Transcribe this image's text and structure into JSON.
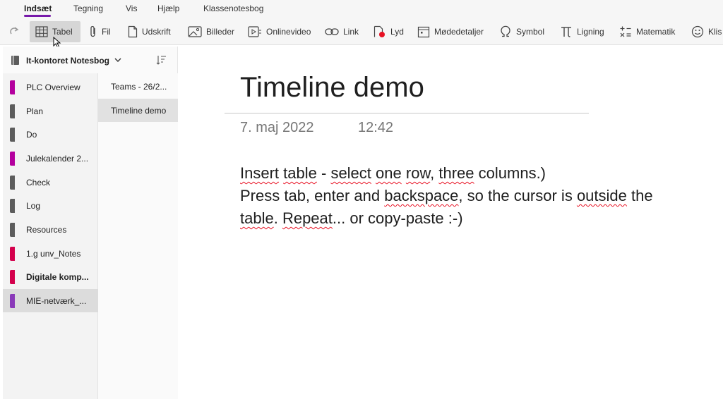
{
  "ribbon": {
    "tabs": [
      {
        "label": "Indsæt",
        "active": true
      },
      {
        "label": "Tegning"
      },
      {
        "label": "Vis"
      },
      {
        "label": "Hjælp"
      },
      {
        "label": "Klassenotesbog"
      }
    ],
    "tools": [
      {
        "label": "Tabel",
        "icon": "table-icon"
      },
      {
        "label": "Fil",
        "icon": "paperclip-icon"
      },
      {
        "label": "Udskrift",
        "icon": "document-icon"
      },
      {
        "label": "Billeder",
        "icon": "image-icon"
      },
      {
        "label": "Onlinevideo",
        "icon": "video-icon"
      },
      {
        "label": "Link",
        "icon": "link-icon"
      },
      {
        "label": "Lyd",
        "icon": "audio-record-icon"
      },
      {
        "label": "Mødedetaljer",
        "icon": "calendar-icon"
      },
      {
        "label": "Symbol",
        "icon": "omega-icon"
      },
      {
        "label": "Ligning",
        "icon": "pi-icon"
      },
      {
        "label": "Matematik",
        "icon": "math-icon"
      },
      {
        "label": "Klis",
        "icon": "sticker-icon"
      }
    ],
    "accent_color": "#7719aa"
  },
  "notebook": {
    "name": "It-kontoret Notesbog",
    "sections": [
      {
        "label": "PLC Overview",
        "color": "#b4009e"
      },
      {
        "label": "Plan",
        "color": "#5c5c5c"
      },
      {
        "label": "Do",
        "color": "#5c5c5c"
      },
      {
        "label": "Julekalender 2...",
        "color": "#b4009e"
      },
      {
        "label": "Check",
        "color": "#5c5c5c"
      },
      {
        "label": "Log",
        "color": "#5c5c5c"
      },
      {
        "label": "Resources",
        "color": "#5c5c5c"
      },
      {
        "label": "1.g unv_Notes",
        "color": "#d4004c"
      },
      {
        "label": "Digitale komp...",
        "color": "#d4004c",
        "bold": true
      },
      {
        "label": "MIE-netværk_...",
        "color": "#8a3ab9",
        "selected": true
      }
    ],
    "pages": [
      {
        "label": "Teams - 26/2..."
      },
      {
        "label": "Timeline demo",
        "selected": true
      }
    ]
  },
  "note": {
    "title": "Timeline demo",
    "date": "7. maj 2022",
    "time": "12:42",
    "line1": {
      "w1": "Insert",
      "w2": "table",
      "t3": " - ",
      "w4": "select",
      "t5": " ",
      "w6": "one",
      "t7": " ",
      "w8": "row",
      "t9": ", ",
      "w10": "three",
      "t11": " columns.)"
    },
    "line2": {
      "t1": "Press tab, enter and ",
      "w2": "backspace",
      "t3": ", so the cursor is ",
      "w4": "outside",
      "t5": " the"
    },
    "line3": {
      "w1": "table",
      "t2": ". ",
      "w3": "Repeat",
      "t4": "... or copy-paste :-)"
    }
  }
}
